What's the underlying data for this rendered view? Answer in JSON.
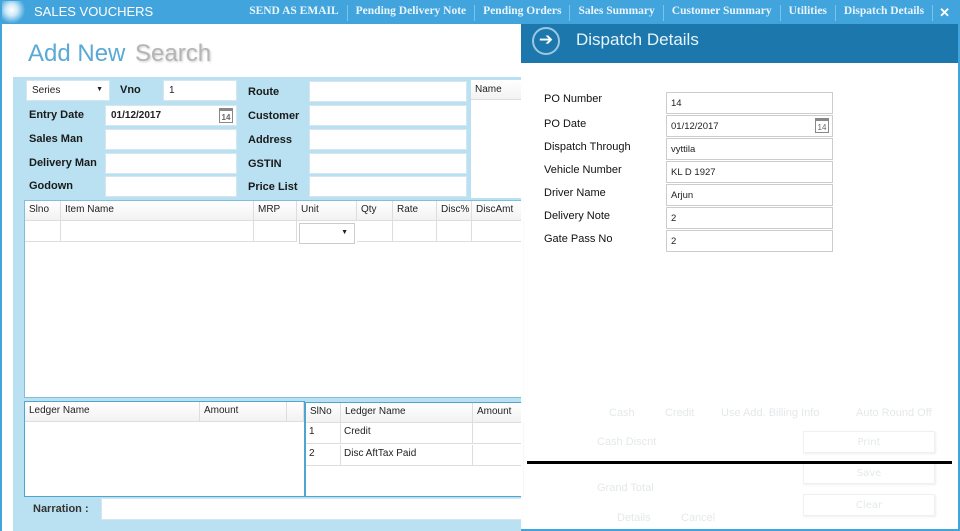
{
  "app": {
    "title": "SALES VOUCHERS",
    "colors": {
      "titlebar": "#41a4dc",
      "panel": "#b9e1f1",
      "overlay_header": "#1c77ac"
    }
  },
  "menu": {
    "items": [
      "SEND AS EMAIL",
      "Pending Delivery Note",
      "Pending Orders",
      "Sales Summary",
      "Customer Summary",
      "Utilities",
      "Dispatch Details"
    ],
    "close": "✕"
  },
  "modes": {
    "add_new": "Add New",
    "search": "Search"
  },
  "form": {
    "series": "Series",
    "vno_label": "Vno",
    "vno": "1",
    "entry_date_label": "Entry Date",
    "entry_date": "01/12/2017",
    "sales_man_label": "Sales Man",
    "delivery_man_label": "Delivery Man",
    "godown_label": "Godown",
    "route_label": "Route",
    "customer_label": "Customer",
    "address_label": "Address",
    "gstin_label": "GSTIN",
    "price_list_label": "Price List",
    "name_header": "Name",
    "calendar_day": "14"
  },
  "items_grid": {
    "columns": [
      "Slno",
      "Item Name",
      "MRP",
      "Unit",
      "Qty",
      "Rate",
      "Disc%",
      "DiscAmt"
    ]
  },
  "ledger_left": {
    "columns": [
      "Ledger Name",
      "Amount"
    ]
  },
  "ledger_right": {
    "columns": [
      "SlNo",
      "Ledger Name",
      "Amount"
    ],
    "rows": [
      [
        "1",
        "Credit",
        ""
      ],
      [
        "2",
        "Disc AftTax Paid",
        ""
      ]
    ]
  },
  "narration": {
    "label": "Narration :"
  },
  "dispatch": {
    "title": "Dispatch Details",
    "fields": [
      {
        "label": "PO Number",
        "value": "14"
      },
      {
        "label": "PO Date",
        "value": "01/12/2017"
      },
      {
        "label": "Dispatch Through",
        "value": "vyttila"
      },
      {
        "label": "Vehicle Number",
        "value": "KL D 1927"
      },
      {
        "label": "Driver Name",
        "value": "Arjun"
      },
      {
        "label": "Delivery Note",
        "value": "2"
      },
      {
        "label": "Gate Pass No",
        "value": "2"
      }
    ]
  },
  "background_faded": {
    "cash": "Cash",
    "credit": "Credit",
    "add_billing": "Use Add. Billing Info",
    "auto_round": "Auto Round Off",
    "cash_discount": "Cash Discnt",
    "grand_total": "Grand Total",
    "print": "Print",
    "save": "Save",
    "clear": "Clear",
    "details": "Details",
    "cancel": "Cancel"
  }
}
